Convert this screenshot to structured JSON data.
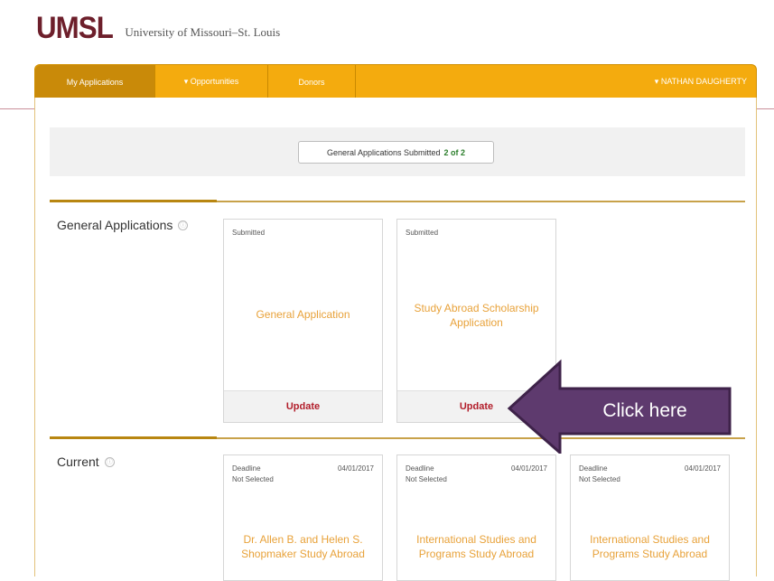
{
  "brand": {
    "mark": "UMSL",
    "name": "University of Missouri–St. Louis"
  },
  "navbar": {
    "tabs": [
      {
        "label": "My Applications",
        "active": true
      },
      {
        "label": "▾ Opportunities",
        "active": false
      },
      {
        "label": "Donors",
        "active": false
      }
    ],
    "user": "▾ NATHAN DAUGHERTY"
  },
  "summary": {
    "label": "General Applications Submitted",
    "count": "2 of 2"
  },
  "general_section": {
    "title": "General Applications",
    "info_icon": "ⓘ",
    "cards": [
      {
        "status": "Submitted",
        "name": "General Application",
        "action": "Update"
      },
      {
        "status": "Submitted",
        "name": "Study Abroad Scholarship Application",
        "action": "Update"
      }
    ]
  },
  "current_section": {
    "title": "Current",
    "info_icon": "ⓘ",
    "cards": [
      {
        "deadline_label": "Deadline",
        "deadline": "04/01/2017",
        "selection": "Not Selected",
        "name": "Dr. Allen B. and Helen S. Shopmaker Study Abroad"
      },
      {
        "deadline_label": "Deadline",
        "deadline": "04/01/2017",
        "selection": "Not Selected",
        "name": "International Studies and Programs Study Abroad"
      },
      {
        "deadline_label": "Deadline",
        "deadline": "04/01/2017",
        "selection": "Not Selected",
        "name": "International Studies and Programs Study Abroad"
      }
    ]
  },
  "callout": {
    "label": "Click here",
    "fill": "#5e3a6e",
    "stroke": "#3e2249"
  },
  "colors": {
    "brand": "#6d1f2b",
    "nav": "#f4ab0e",
    "accent_text": "#e8a23a",
    "update": "#b21e2b",
    "count": "#2a7d2a"
  }
}
